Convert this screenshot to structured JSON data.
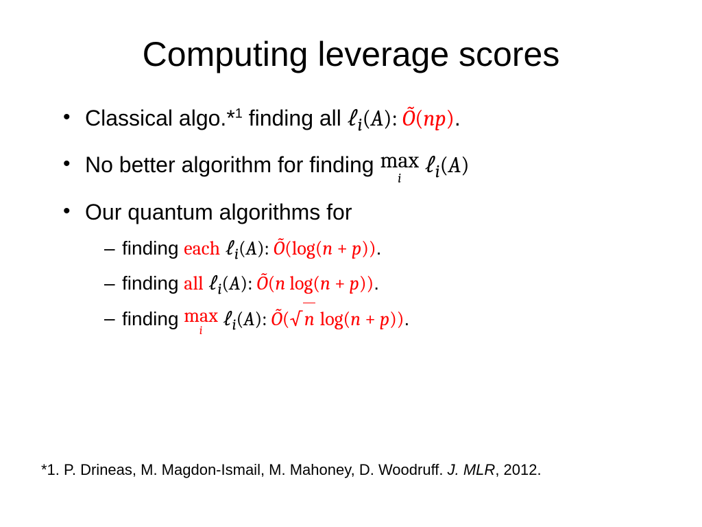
{
  "title": "Computing leverage scores",
  "bullets": {
    "b1": {
      "pre": "Classical algo.*",
      "supnote": "1",
      "mid": " finding all ",
      "ell": "ℓ",
      "sub": "i",
      "paren": "(",
      "A": "A",
      "close_colon": "): ",
      "tilde_O": "Õ",
      "open2": "(",
      "np": "np",
      "close2": ")",
      "dot": "."
    },
    "b2": {
      "pre": "No better algorithm for finding ",
      "max": "max",
      "max_sub": "i",
      "space": " ",
      "ell": "ℓ",
      "sub": "i",
      "paren": "(",
      "A": "A",
      "close": ")"
    },
    "b3": {
      "pre": "Our quantum algorithms for"
    },
    "sub1": {
      "pre": "finding ",
      "word": "each",
      "space": " ",
      "ell": "ℓ",
      "sub": "i",
      "paren": "(",
      "A": "A",
      "close_colon": "): ",
      "tilde_O": "Õ",
      "open2": "(",
      "log": "log",
      "open3": "(",
      "n": "n",
      "plus": " + ",
      "p": "p",
      "close3": ")",
      "close2": ")",
      "dot": "."
    },
    "sub2": {
      "pre": "finding ",
      "word": "all",
      "space": " ",
      "ell": "ℓ",
      "sub": "i",
      "paren": "(",
      "A": "A",
      "close_colon": "): ",
      "tilde_O": "Õ",
      "open2": "(",
      "n": "n",
      "sp": " ",
      "log": "log",
      "open3": "(",
      "n2": "n",
      "plus": " + ",
      "p": "p",
      "close3": ")",
      "close2": ")",
      "dot": "."
    },
    "sub3": {
      "pre": "finding ",
      "max": "max",
      "max_sub": "i",
      "space": " ",
      "ell": "ℓ",
      "sub": "i",
      "paren": "(",
      "A": "A",
      "close_colon": "): ",
      "tilde_O": "Õ",
      "open2": "(",
      "sqrt_sym": "√",
      "sqrt_in": "n",
      "sp": " ",
      "log": "log",
      "open3": "(",
      "n2": "n",
      "plus": " + ",
      "p": "p",
      "close3": ")",
      "close2": ")",
      "dot": "."
    }
  },
  "footnote": {
    "marker": "*1. ",
    "authors": "P. Drineas, M. Magdon-Ismail, M. Mahoney, D. Woodruff. ",
    "journal": "J. MLR",
    "year": ", 2012."
  }
}
